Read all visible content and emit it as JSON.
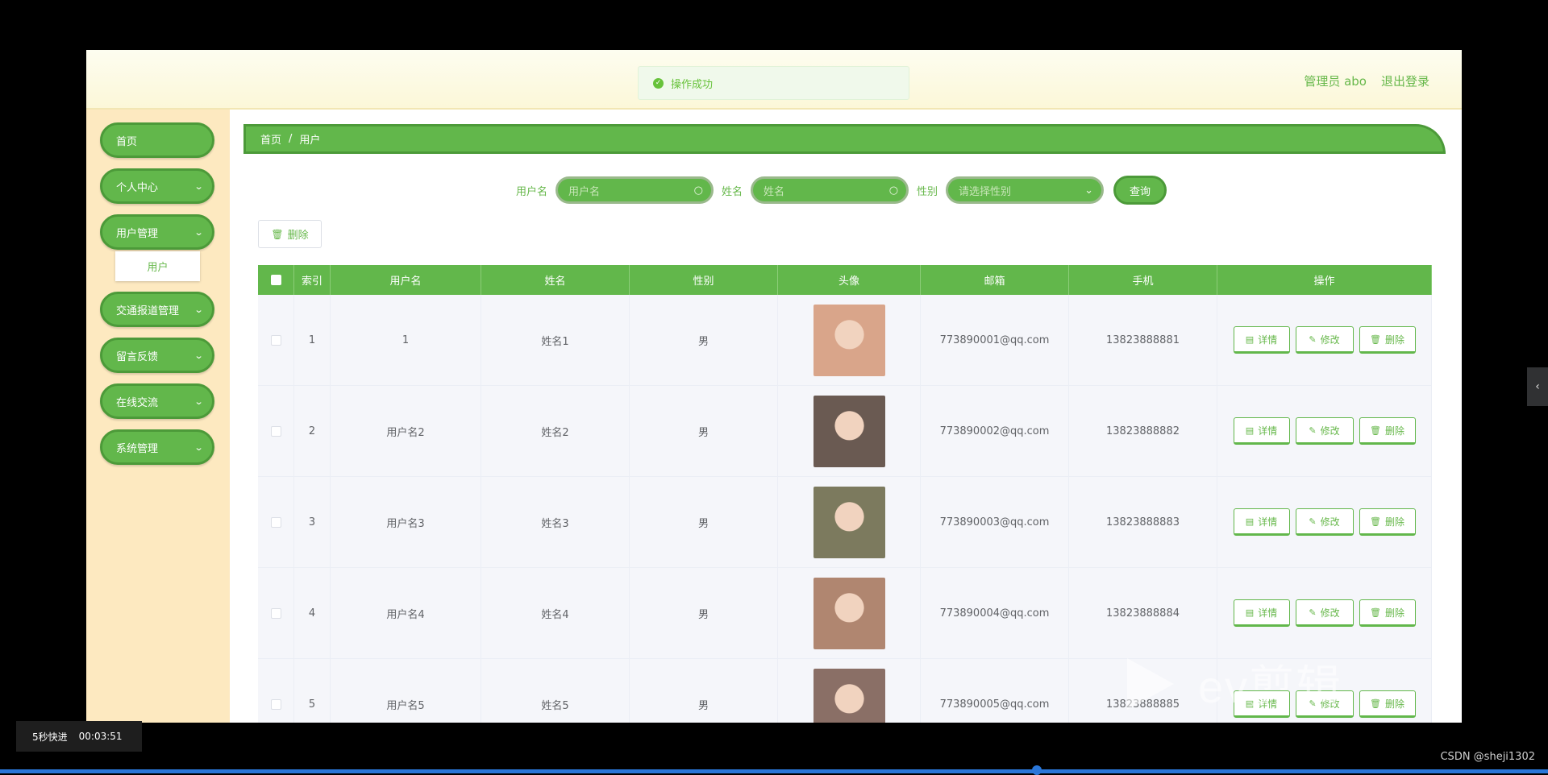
{
  "header": {
    "toast": "操作成功",
    "user": "管理员 abo",
    "logout": "退出登录"
  },
  "sidebar": {
    "items": [
      {
        "label": "首页",
        "has_arrow": false
      },
      {
        "label": "个人中心",
        "has_arrow": true
      },
      {
        "label": "用户管理",
        "has_arrow": true
      },
      {
        "label": "交通报道管理",
        "has_arrow": true
      },
      {
        "label": "留言反馈",
        "has_arrow": true
      },
      {
        "label": "在线交流",
        "has_arrow": true
      },
      {
        "label": "系统管理",
        "has_arrow": true
      }
    ],
    "sub_item": "用户"
  },
  "breadcrumb": {
    "home": "首页",
    "sep": "/",
    "current": "用户"
  },
  "search": {
    "username_label": "用户名",
    "username_placeholder": "用户名",
    "name_label": "姓名",
    "name_placeholder": "姓名",
    "gender_label": "性别",
    "gender_placeholder": "请选择性别",
    "query_button": "查询"
  },
  "toolbar": {
    "delete_button": "删除"
  },
  "table": {
    "headers": [
      "",
      "索引",
      "用户名",
      "姓名",
      "性别",
      "头像",
      "邮箱",
      "手机",
      "操作"
    ],
    "rows": [
      {
        "index": "1",
        "username": "1",
        "name": "姓名1",
        "gender": "男",
        "email": "773890001@qq.com",
        "phone": "13823888881",
        "avatar_color": "#d9a58a"
      },
      {
        "index": "2",
        "username": "用户名2",
        "name": "姓名2",
        "gender": "男",
        "email": "773890002@qq.com",
        "phone": "13823888882",
        "avatar_color": "#6a5a52"
      },
      {
        "index": "3",
        "username": "用户名3",
        "name": "姓名3",
        "gender": "男",
        "email": "773890003@qq.com",
        "phone": "13823888883",
        "avatar_color": "#7c7a5e"
      },
      {
        "index": "4",
        "username": "用户名4",
        "name": "姓名4",
        "gender": "男",
        "email": "773890004@qq.com",
        "phone": "13823888884",
        "avatar_color": "#b08670"
      },
      {
        "index": "5",
        "username": "用户名5",
        "name": "姓名5",
        "gender": "男",
        "email": "773890005@qq.com",
        "phone": "13823888885",
        "avatar_color": "#8a6f66"
      }
    ],
    "actions": {
      "detail": "详情",
      "edit": "修改",
      "delete": "删除"
    }
  },
  "overlay": {
    "speed": "5秒快进",
    "time": "00:03:51",
    "watermark": "ev剪辑",
    "credit": "CSDN @sheji1302"
  }
}
